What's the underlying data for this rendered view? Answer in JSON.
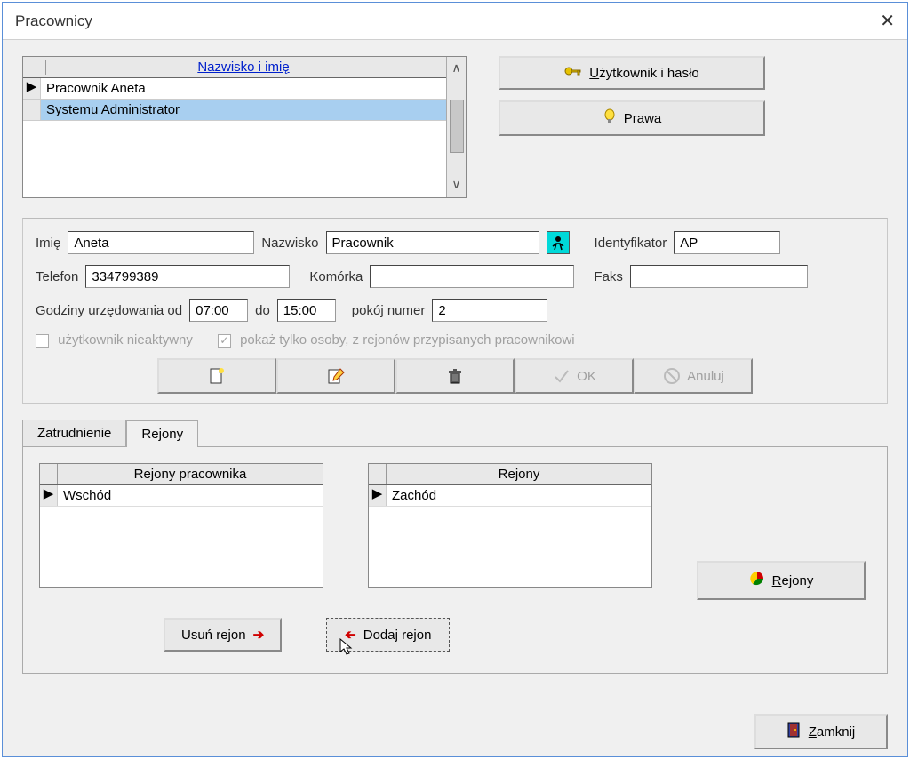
{
  "window": {
    "title": "Pracownicy"
  },
  "employeeList": {
    "header": "Nazwisko i imię",
    "rows": [
      {
        "name": "Pracownik Aneta",
        "selected": false,
        "marker": "▶"
      },
      {
        "name": "Systemu Administrator",
        "selected": true,
        "marker": ""
      }
    ]
  },
  "sideButtons": {
    "user_password": "Użytkownik i hasło",
    "rights": "Prawa"
  },
  "form": {
    "labels": {
      "imie": "Imię",
      "nazwisko": "Nazwisko",
      "ident": "Identyfikator",
      "telefon": "Telefon",
      "komorka": "Komórka",
      "faks": "Faks",
      "godziny": "Godziny urzędowania od",
      "do": "do",
      "pokoj": "pokój numer",
      "chk_inactive": "użytkownik nieaktywny",
      "chk_showonly": "pokaż tylko osoby, z rejonów przypisanych pracownikowi"
    },
    "values": {
      "imie": "Aneta",
      "nazwisko": "Pracownik",
      "ident": "AP",
      "telefon": "334799389",
      "komorka": "",
      "faks": "",
      "od": "07:00",
      "do": "15:00",
      "pokoj": "2"
    }
  },
  "toolbar": {
    "ok": "OK",
    "anuluj": "Anuluj"
  },
  "tabs": {
    "zatrudnienie": "Zatrudnienie",
    "rejony": "Rejony"
  },
  "regions": {
    "pracownika_header": "Rejony pracownika",
    "all_header": "Rejony",
    "pracownika_rows": [
      "Wschód"
    ],
    "all_rows": [
      "Zachód"
    ],
    "btn_usun": "Usuń rejon",
    "btn_dodaj": "Dodaj rejon",
    "btn_rejony": "Rejony"
  },
  "footer": {
    "close": "Zamknij"
  }
}
